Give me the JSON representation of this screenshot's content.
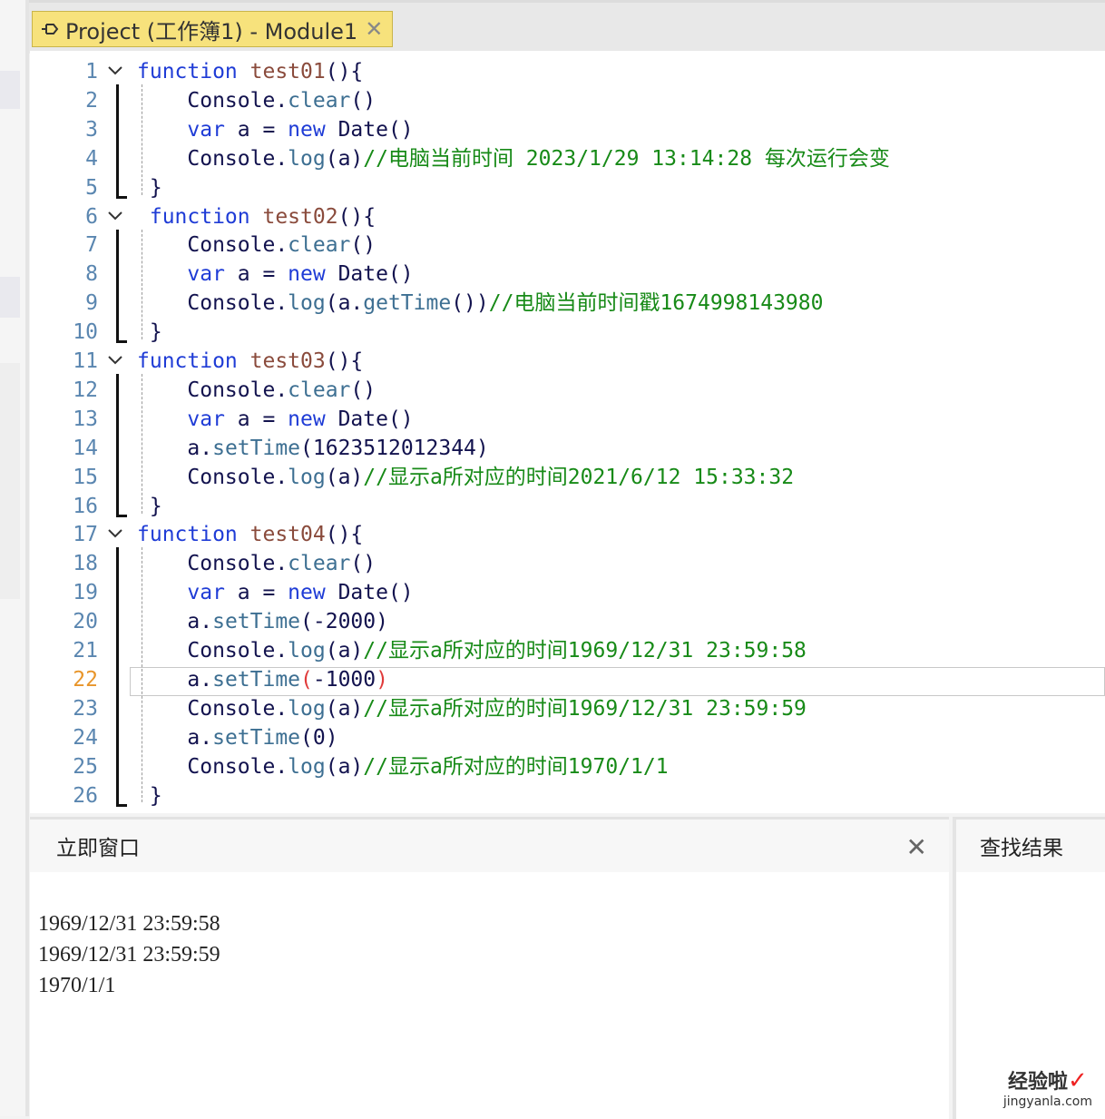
{
  "tab": {
    "title": "Project (工作簿1) - Module1",
    "close_icon": "close-icon",
    "pin_icon": "pin-icon"
  },
  "editor": {
    "current_line": 22,
    "lines": [
      {
        "n": 1,
        "fold": true,
        "t": [
          [
            "kw",
            "function "
          ],
          [
            "fn",
            "test01"
          ],
          [
            "pn",
            "(){"
          ]
        ]
      },
      {
        "n": 2,
        "t": [
          [
            "id",
            "    Console."
          ],
          [
            "mt",
            "clear"
          ],
          [
            "pn",
            "()"
          ]
        ]
      },
      {
        "n": 3,
        "t": [
          [
            "kw",
            "    var "
          ],
          [
            "id",
            "a = "
          ],
          [
            "kw",
            "new "
          ],
          [
            "id",
            "Date()"
          ]
        ]
      },
      {
        "n": 4,
        "t": [
          [
            "id",
            "    Console."
          ],
          [
            "mt",
            "log"
          ],
          [
            "pn",
            "(a)"
          ],
          [
            "cm",
            "//电脑当前时间 2023/1/29 13:14:28 每次运行会变"
          ]
        ]
      },
      {
        "n": 5,
        "t": [
          [
            "pn",
            " }"
          ]
        ]
      },
      {
        "n": 6,
        "fold": true,
        "t": [
          [
            "kw",
            " function "
          ],
          [
            "fn",
            "test02"
          ],
          [
            "pn",
            "(){"
          ]
        ]
      },
      {
        "n": 7,
        "t": [
          [
            "id",
            "    Console."
          ],
          [
            "mt",
            "clear"
          ],
          [
            "pn",
            "()"
          ]
        ]
      },
      {
        "n": 8,
        "t": [
          [
            "kw",
            "    var "
          ],
          [
            "id",
            "a = "
          ],
          [
            "kw",
            "new "
          ],
          [
            "id",
            "Date()"
          ]
        ]
      },
      {
        "n": 9,
        "t": [
          [
            "id",
            "    Console."
          ],
          [
            "mt",
            "log"
          ],
          [
            "pn",
            "(a."
          ],
          [
            "mt",
            "getTime"
          ],
          [
            "pn",
            "())"
          ],
          [
            "cm",
            "//电脑当前时间戳1674998143980"
          ]
        ]
      },
      {
        "n": 10,
        "t": [
          [
            "pn",
            " }"
          ]
        ]
      },
      {
        "n": 11,
        "fold": true,
        "t": [
          [
            "kw",
            "function "
          ],
          [
            "fn",
            "test03"
          ],
          [
            "pn",
            "(){"
          ]
        ]
      },
      {
        "n": 12,
        "t": [
          [
            "id",
            "    Console."
          ],
          [
            "mt",
            "clear"
          ],
          [
            "pn",
            "()"
          ]
        ]
      },
      {
        "n": 13,
        "t": [
          [
            "kw",
            "    var "
          ],
          [
            "id",
            "a = "
          ],
          [
            "kw",
            "new "
          ],
          [
            "id",
            "Date()"
          ]
        ]
      },
      {
        "n": 14,
        "t": [
          [
            "id",
            "    a."
          ],
          [
            "mt",
            "setTime"
          ],
          [
            "pn",
            "("
          ],
          [
            "num",
            "1623512012344"
          ],
          [
            "pn",
            ")"
          ]
        ]
      },
      {
        "n": 15,
        "t": [
          [
            "id",
            "    Console."
          ],
          [
            "mt",
            "log"
          ],
          [
            "pn",
            "(a)"
          ],
          [
            "cm",
            "//显示a所对应的时间2021/6/12 15:33:32"
          ]
        ]
      },
      {
        "n": 16,
        "t": [
          [
            "pn",
            " }"
          ]
        ]
      },
      {
        "n": 17,
        "fold": true,
        "t": [
          [
            "kw",
            "function "
          ],
          [
            "fn",
            "test04"
          ],
          [
            "pn",
            "(){"
          ]
        ]
      },
      {
        "n": 18,
        "t": [
          [
            "id",
            "    Console."
          ],
          [
            "mt",
            "clear"
          ],
          [
            "pn",
            "()"
          ]
        ]
      },
      {
        "n": 19,
        "t": [
          [
            "kw",
            "    var "
          ],
          [
            "id",
            "a = "
          ],
          [
            "kw",
            "new "
          ],
          [
            "id",
            "Date()"
          ]
        ]
      },
      {
        "n": 20,
        "t": [
          [
            "id",
            "    a."
          ],
          [
            "mt",
            "setTime"
          ],
          [
            "pn",
            "("
          ],
          [
            "num",
            "-2000"
          ],
          [
            "pn",
            ")"
          ]
        ]
      },
      {
        "n": 21,
        "t": [
          [
            "id",
            "    Console."
          ],
          [
            "mt",
            "log"
          ],
          [
            "pn",
            "(a)"
          ],
          [
            "cm",
            "//显示a所对应的时间1969/12/31 23:59:58"
          ]
        ]
      },
      {
        "n": 22,
        "t": [
          [
            "id",
            "    a."
          ],
          [
            "mt",
            "setTime"
          ],
          [
            "err",
            "("
          ],
          [
            "num",
            "-1000"
          ],
          [
            "err",
            ")"
          ]
        ]
      },
      {
        "n": 23,
        "t": [
          [
            "id",
            "    Console."
          ],
          [
            "mt",
            "log"
          ],
          [
            "pn",
            "(a)"
          ],
          [
            "cm",
            "//显示a所对应的时间1969/12/31 23:59:59"
          ]
        ]
      },
      {
        "n": 24,
        "t": [
          [
            "id",
            "    a."
          ],
          [
            "mt",
            "setTime"
          ],
          [
            "pn",
            "("
          ],
          [
            "num",
            "0"
          ],
          [
            "pn",
            ")"
          ]
        ]
      },
      {
        "n": 25,
        "t": [
          [
            "id",
            "    Console."
          ],
          [
            "mt",
            "log"
          ],
          [
            "pn",
            "(a)"
          ],
          [
            "cm",
            "//显示a所对应的时间1970/1/1"
          ]
        ]
      },
      {
        "n": 26,
        "t": [
          [
            "pn",
            " }"
          ]
        ]
      }
    ]
  },
  "immediate": {
    "title": "立即窗口",
    "close_icon": "close-icon",
    "output": [
      "1969/12/31 23:59:58",
      "1969/12/31 23:59:59",
      "1970/1/1"
    ]
  },
  "find_results": {
    "title": "查找结果"
  },
  "watermark": {
    "text": "经验啦",
    "url": "jingyanla.com"
  }
}
